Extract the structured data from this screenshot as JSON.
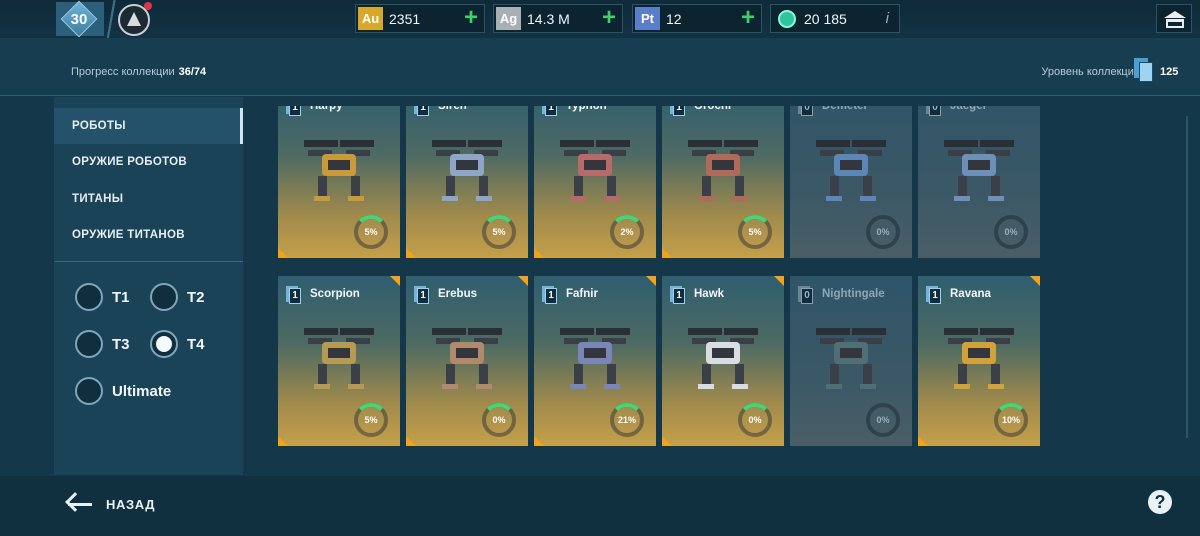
{
  "topbar": {
    "player_level": "30",
    "currencies": [
      {
        "icon_label": "Au",
        "icon_name": "gold-icon",
        "value": "2351",
        "color": "#d8a82a",
        "has_plus": true
      },
      {
        "icon_label": "Ag",
        "icon_name": "silver-icon",
        "value": "14.3 M",
        "color": "#a9b0b4",
        "has_plus": true
      },
      {
        "icon_label": "Pt",
        "icon_name": "platinum-icon",
        "value": "12",
        "color": "#5a7fc8",
        "has_plus": true
      },
      {
        "icon_label": "",
        "icon_name": "gem-icon",
        "value": "20 185",
        "color": "#2ec4a0",
        "has_info": true
      }
    ],
    "info_glyph": "i",
    "plus_glyph": "+"
  },
  "header": {
    "progress_label": "Прогресс коллекции",
    "progress_value": "36/74",
    "collection_level_label": "Уровень коллекции",
    "collection_level_value": "125"
  },
  "sidebar": {
    "items": [
      {
        "label": "РОБОТЫ",
        "active": true
      },
      {
        "label": "ОРУЖИЕ РОБОТОВ",
        "active": false
      },
      {
        "label": "ТИТАНЫ",
        "active": false
      },
      {
        "label": "ОРУЖИЕ ТИТАНОВ",
        "active": false
      }
    ],
    "tiers": [
      {
        "label": "T1",
        "selected": false
      },
      {
        "label": "T2",
        "selected": false
      },
      {
        "label": "T3",
        "selected": false
      },
      {
        "label": "T4",
        "selected": true
      },
      {
        "label": "Ultimate",
        "selected": false
      }
    ]
  },
  "cards": {
    "row1": [
      {
        "name": "Harpy",
        "level": "1",
        "progress": "5%",
        "dim": false,
        "body_color": "#c89a3a"
      },
      {
        "name": "Siren",
        "level": "1",
        "progress": "5%",
        "dim": false,
        "body_color": "#8fa6c6"
      },
      {
        "name": "Typhon",
        "level": "1",
        "progress": "2%",
        "dim": false,
        "body_color": "#b66a6a"
      },
      {
        "name": "Orochi",
        "level": "1",
        "progress": "5%",
        "dim": false,
        "body_color": "#b06a5a"
      },
      {
        "name": "Demeter",
        "level": "0",
        "progress": "0%",
        "dim": true,
        "body_color": "#5b86b5"
      },
      {
        "name": "Jaeger",
        "level": "0",
        "progress": "0%",
        "dim": true,
        "body_color": "#6d8fb8"
      }
    ],
    "row2": [
      {
        "name": "Scorpion",
        "level": "1",
        "progress": "5%",
        "dim": false,
        "body_color": "#b49a52"
      },
      {
        "name": "Erebus",
        "level": "1",
        "progress": "0%",
        "dim": false,
        "body_color": "#b08a6a"
      },
      {
        "name": "Fafnir",
        "level": "1",
        "progress": "21%",
        "dim": false,
        "body_color": "#7b86b8"
      },
      {
        "name": "Hawk",
        "level": "1",
        "progress": "0%",
        "dim": false,
        "body_color": "#d8dde2"
      },
      {
        "name": "Nightingale",
        "level": "0",
        "progress": "0%",
        "dim": true,
        "body_color": "#4f6f74"
      },
      {
        "name": "Ravana",
        "level": "1",
        "progress": "10%",
        "dim": false,
        "body_color": "#d2a23a"
      }
    ]
  },
  "footer": {
    "back_label": "НАЗАД",
    "help_glyph": "?"
  }
}
